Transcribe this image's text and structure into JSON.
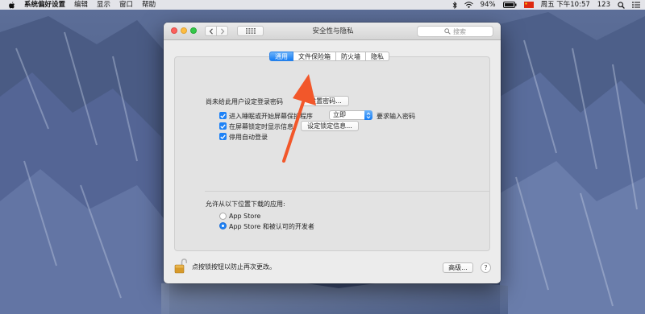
{
  "menubar": {
    "app_name": "系统偏好设置",
    "menus": [
      "编辑",
      "显示",
      "窗口",
      "帮助"
    ],
    "battery": "94%",
    "clock": "周五 下午10:57",
    "input_method": "123"
  },
  "window": {
    "title": "安全性与隐私",
    "search_placeholder": "搜索",
    "tabs": [
      "通用",
      "文件保险箱",
      "防火墙",
      "隐私"
    ],
    "active_tab": "通用"
  },
  "general": {
    "password_notice": "尚未给此用户设定登录密码",
    "set_password_button": "设置密码...",
    "require_password_label": "进入睡眠或开始屏幕保护程序",
    "require_password_select": "立即",
    "require_password_suffix": "要求输入密码",
    "show_message_label": "在屏幕锁定时显示信息",
    "set_lock_message_button": "设定锁定信息...",
    "disable_auto_login_label": "停用自动登录",
    "allow_apps_label": "允许从以下位置下载的应用:",
    "option_app_store": "App Store",
    "option_app_store_devs": "App Store 和被认可的开发者"
  },
  "footer": {
    "lock_text": "点按锁按钮以防止再次更改。",
    "advanced_button": "高级...",
    "help_button": "?"
  },
  "colors": {
    "accent_blue": "#137cf5",
    "annotation_arrow": "#f2572a"
  }
}
